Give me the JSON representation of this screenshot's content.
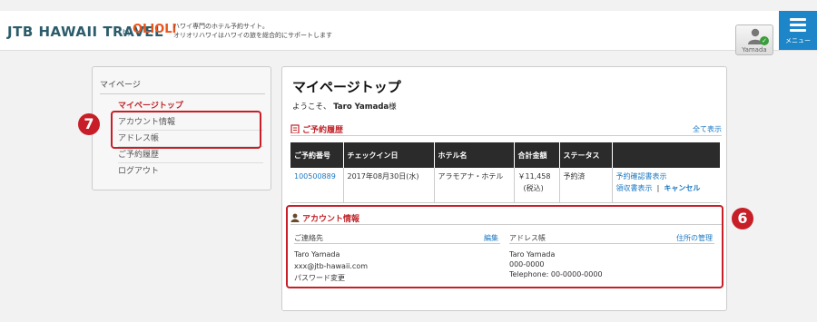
{
  "header": {
    "logo_text": "JTB HAWAII TRAVEL",
    "logo_by": "by",
    "logo_ohana": "OLIOLI",
    "tagline_1": "ハワイ専門のホテル予約サイト。",
    "tagline_2": "オリオリハワイはハワイの旅を総合的にサポートします",
    "user_name": "Yamada",
    "menu_label": "メニュー"
  },
  "sidebar": {
    "title": "マイページ",
    "items": [
      {
        "label": "マイページトップ"
      },
      {
        "label": "アカウント情報"
      },
      {
        "label": "アドレス帳"
      },
      {
        "label": "ご予約履歴"
      },
      {
        "label": "ログアウト"
      }
    ]
  },
  "callouts": {
    "seven": "7",
    "six": "6"
  },
  "main": {
    "title": "マイページトップ",
    "welcome_prefix": "ようこそ、",
    "welcome_name": "Taro Yamada",
    "welcome_suffix": "様",
    "history": {
      "title": "ご予約履歴",
      "show_all": "全て表示",
      "columns": [
        "ご予約番号",
        "チェックイン日",
        "ホテル名",
        "合計金額",
        "ステータス",
        ""
      ],
      "row": {
        "number": "100500889",
        "checkin": "2017年08月30日(水)",
        "hotel": "アラモアナ・ホテル",
        "amount": "￥11,458",
        "tax": "(税込)",
        "status": "予約済",
        "confirm_link": "予約確認書表示",
        "receipt_link": "領収書表示",
        "sep": "|",
        "cancel_link": "キャンセル"
      }
    },
    "account": {
      "title": "アカウント情報",
      "contact_label": "ご連絡先",
      "edit_link": "編集",
      "contact_name": "Taro Yamada",
      "contact_email": "xxx@jtb-hawaii.com",
      "password_link": "パスワード変更",
      "address_label": "アドレス帳",
      "address_link": "住所の管理",
      "address_name": "Taro Yamada",
      "address_zip": "000-0000",
      "address_phone": "Telephone: 00-0000-0000"
    }
  },
  "colors": {
    "accent_red": "#c81e28",
    "link_blue": "#1d78c2",
    "menu_blue": "#1d86c8"
  }
}
